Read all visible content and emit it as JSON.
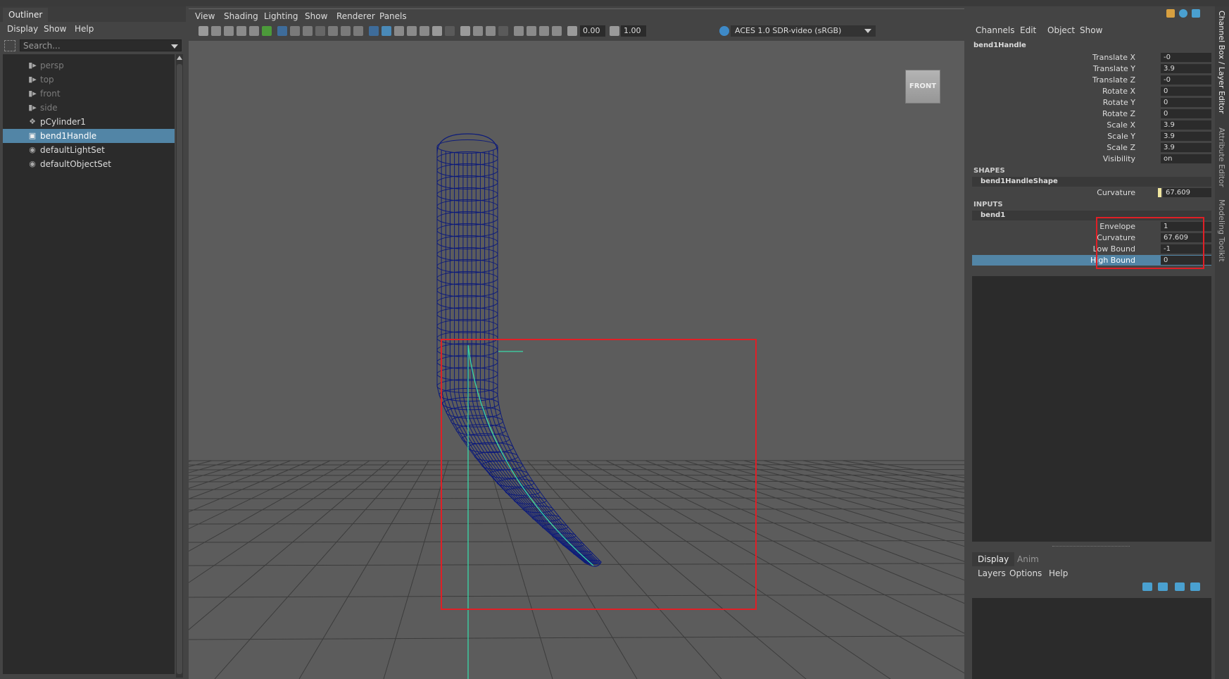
{
  "outliner": {
    "tab_label": "Outliner",
    "menu": [
      "Display",
      "Show",
      "Help"
    ],
    "search_placeholder": "Search...",
    "items": [
      {
        "label": "persp",
        "icon": "camera-icon"
      },
      {
        "label": "top",
        "icon": "camera-icon"
      },
      {
        "label": "front",
        "icon": "camera-icon"
      },
      {
        "label": "side",
        "icon": "camera-icon"
      },
      {
        "label": "pCylinder1",
        "icon": "transform-icon"
      },
      {
        "label": "bend1Handle",
        "icon": "deformer-handle-icon",
        "selected": true
      },
      {
        "label": "defaultLightSet",
        "icon": "set-icon"
      },
      {
        "label": "defaultObjectSet",
        "icon": "set-icon"
      }
    ]
  },
  "viewport": {
    "menu": [
      "View",
      "Shading",
      "Lighting",
      "Show",
      "Renderer",
      "Panels"
    ],
    "exposure": "0.00",
    "gamma": "1.00",
    "color_space": "ACES 1.0 SDR-video (sRGB)",
    "view_cube_label": "FRONT",
    "colors": {
      "wireframe": "#0d1b7a",
      "handle": "#38d8a8",
      "grid": "#3c3c3c",
      "annotation": "#e01f26"
    }
  },
  "channel_box": {
    "menu": [
      "Channels",
      "Edit",
      "Object",
      "Show"
    ],
    "node_name": "bend1Handle",
    "attributes": [
      {
        "name": "Translate X",
        "value": "-0"
      },
      {
        "name": "Translate Y",
        "value": "3.9"
      },
      {
        "name": "Translate Z",
        "value": "-0"
      },
      {
        "name": "Rotate X",
        "value": "0"
      },
      {
        "name": "Rotate Y",
        "value": "0"
      },
      {
        "name": "Rotate Z",
        "value": "0"
      },
      {
        "name": "Scale X",
        "value": "3.9"
      },
      {
        "name": "Scale Y",
        "value": "3.9"
      },
      {
        "name": "Scale Z",
        "value": "3.9"
      },
      {
        "name": "Visibility",
        "value": "on"
      }
    ],
    "shapes_header": "SHAPES",
    "shape_node": "bend1HandleShape",
    "shape_attributes": [
      {
        "name": "Curvature",
        "value": "67.609"
      }
    ],
    "inputs_header": "INPUTS",
    "input_node": "bend1",
    "input_attributes": [
      {
        "name": "Envelope",
        "value": "1"
      },
      {
        "name": "Curvature",
        "value": "67.609"
      },
      {
        "name": "Low Bound",
        "value": "-1"
      },
      {
        "name": "High Bound",
        "value": "0",
        "selected": true
      }
    ]
  },
  "layer_editor": {
    "tabs": [
      "Display",
      "Anim"
    ],
    "menu": [
      "Layers",
      "Options",
      "Help"
    ]
  },
  "side_tabs": [
    "Channel Box / Layer Editor",
    "Attribute Editor",
    "Modeling Toolkit"
  ]
}
